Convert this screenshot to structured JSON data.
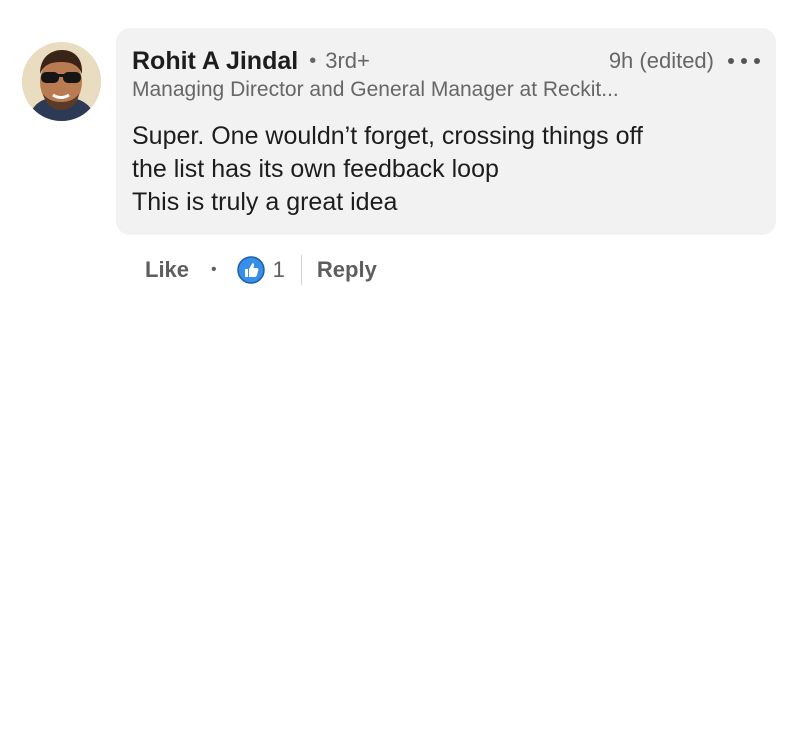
{
  "comment": {
    "author": {
      "name": "Rohit A Jindal",
      "degree": "3rd+",
      "headline": "Managing Director and General Manager at Reckit..."
    },
    "time": "9h (edited)",
    "more_icon": "more-options-icon",
    "body_lines": [
      "Super. One wouldn’t forget, crossing things off",
      "the list has its own feedback loop",
      "This is truly a great idea"
    ]
  },
  "actions": {
    "like_label": "Like",
    "reaction_icon": "thumbs-up-reaction-icon",
    "reaction_count": "1",
    "reply_label": "Reply"
  },
  "colors": {
    "bubble_bg": "#f2f2f2",
    "secondary_text": "#666666",
    "reaction_blue": "#378fe9"
  }
}
